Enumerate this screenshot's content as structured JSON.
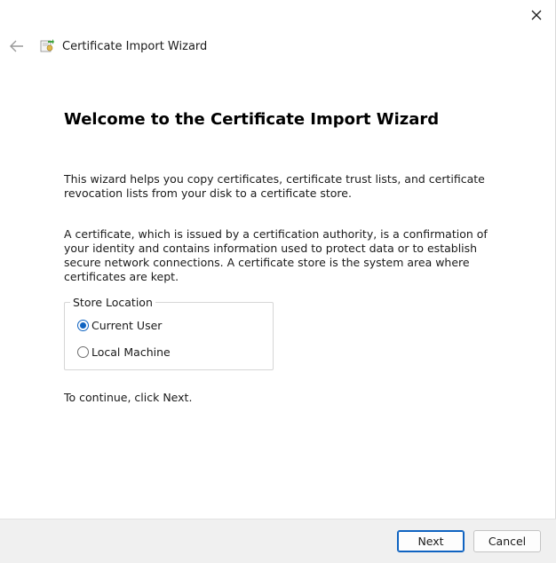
{
  "header": {
    "title": "Certificate Import Wizard",
    "back_icon": "arrow-left-icon",
    "app_icon": "certificate-icon"
  },
  "window": {
    "close_icon": "close-icon"
  },
  "main": {
    "heading": "Welcome to the Certificate Import Wizard",
    "paragraph1": "This wizard helps you copy certificates, certificate trust lists, and certificate revocation lists from your disk to a certificate store.",
    "paragraph2": "A certificate, which is issued by a certification authority, is a confirmation of your identity and contains information used to protect data or to establish secure network connections. A certificate store is the system area where certificates are kept.",
    "store_location": {
      "legend": "Store Location",
      "options": [
        {
          "label": "Current User",
          "selected": true
        },
        {
          "label": "Local Machine",
          "selected": false
        }
      ]
    },
    "continue_text": "To continue, click Next."
  },
  "footer": {
    "next_label": "Next",
    "cancel_label": "Cancel"
  },
  "colors": {
    "accent": "#0f63c1",
    "footer_bg": "#f0f0f0"
  }
}
